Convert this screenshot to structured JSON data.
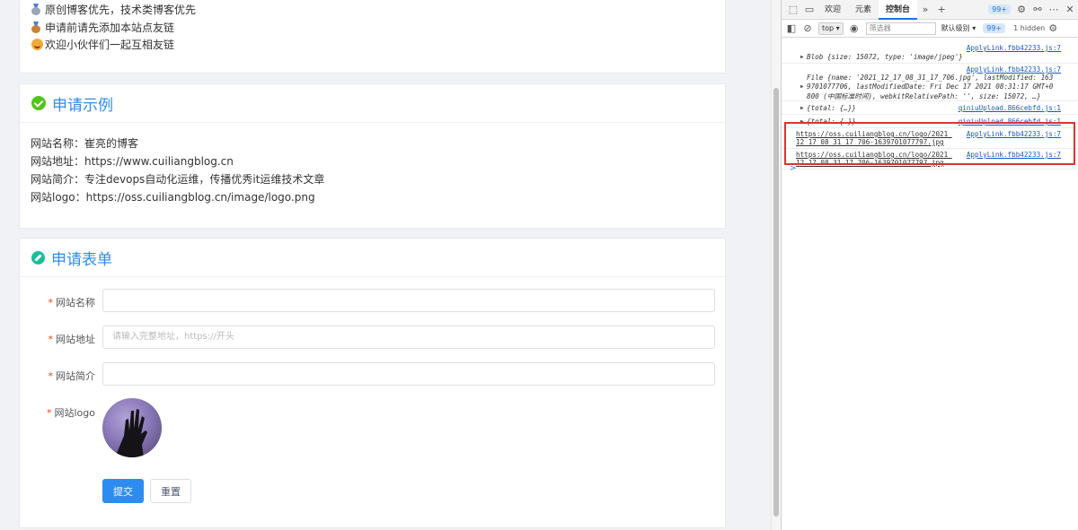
{
  "notices": [
    {
      "icon": "silver-medal-icon",
      "text": "原创博客优先，技术类博客优先",
      "color": "#9aa5b1"
    },
    {
      "icon": "bronze-medal-icon",
      "text": "申请前请先添加本站点友链",
      "color": "#c9803a"
    },
    {
      "icon": "smile-emoji-icon",
      "text": "欢迎小伙伴们一起互相友链",
      "color": "#f2a93b"
    }
  ],
  "example": {
    "title": "申请示例",
    "lines": [
      "网站名称：崔亮的博客",
      "网站地址：https://www.cuiliangblog.cn",
      "网站简介：专注devops自动化运维，传播优秀it运维技术文章",
      "网站logo：https://oss.cuiliangblog.cn/image/logo.png"
    ]
  },
  "form": {
    "title": "申请表单",
    "required_mark": "*",
    "fields": [
      {
        "label": "网站名称",
        "value": "",
        "placeholder": ""
      },
      {
        "label": "网站地址",
        "value": "",
        "placeholder": "请输入完整地址，https://开头"
      },
      {
        "label": "网站简介",
        "value": "",
        "placeholder": ""
      }
    ],
    "logo_label": "网站logo",
    "submit": "提交",
    "reset": "重置"
  },
  "devtools": {
    "tabs": [
      "欢迎",
      "元素",
      "控制台"
    ],
    "active_tab": "控制台",
    "more": "»",
    "add": "+",
    "issues_badge": "99+",
    "toolbar": {
      "context": "top",
      "filter_placeholder": "筛选器",
      "level": "默认级别",
      "badge": "99+",
      "hidden": "1 hidden"
    },
    "logs": [
      {
        "src": "ApplyLink.fbb42233.js:7",
        "line1": "Blob {size: 15072, type: 'image/jpeg'}"
      },
      {
        "src": "ApplyLink.fbb42233.js:7",
        "line1": "File {name: '2021_12_17_08_31_17_706.jpg', lastModified: 163",
        "line2": "9701077706, lastModifiedDate: Fri Dec 17 2021 08:31:17 GMT+0",
        "line3": "800 (中国标准时间), webkitRelativePath: '', size: 15072, …}"
      },
      {
        "src": "qiniuUpload.866cebfd.js:1",
        "line1": "{total: {…}}"
      },
      {
        "src": "qiniuUpload.866cebfd.js:1",
        "line1": "{total: {…}}"
      },
      {
        "src": "ApplyLink.fbb42233.js:7",
        "line1": "https://oss.cuiliangblog.cn/logo/2021_",
        "line2": "12_17_08_31_17_706-1639701077797.jpg"
      },
      {
        "src": "ApplyLink.fbb42233.js:7",
        "line1": "https://oss.cuiliangblog.cn/logo/2021_",
        "line2": "12_17_08_31_17_706-1639701077797.jpg"
      }
    ],
    "prompt": ">"
  }
}
